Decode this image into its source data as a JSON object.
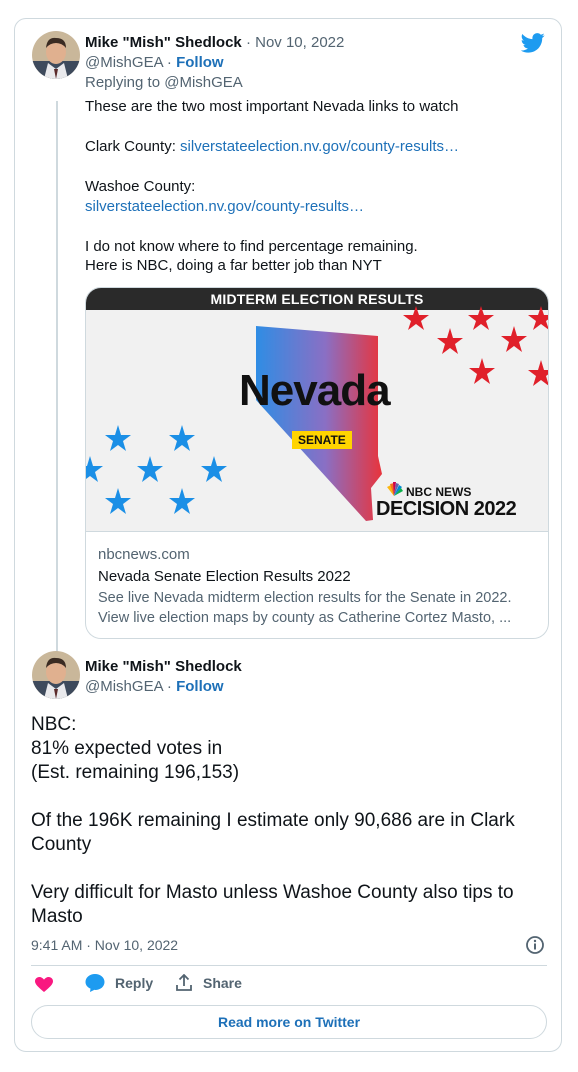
{
  "tweet1": {
    "author_name": "Mike \"Mish\" Shedlock",
    "separator": "·",
    "date": "Nov 10, 2022",
    "handle": "@MishGEA",
    "follow_label": "Follow",
    "replying_to_prefix": "Replying to",
    "replying_to_handle": "@MishGEA",
    "line1": "These are the two most important Nevada links to watch",
    "clark_label": "Clark County:",
    "clark_link": "silverstateelection.nv.gov/county-results…",
    "washoe_label": "Washoe County:",
    "washoe_link": "silverstateelection.nv.gov/county-results…",
    "line_no_know": "I do not know where to find percentage remaining.",
    "line_nbc": "Here is NBC, doing a far better job than NYT"
  },
  "preview": {
    "banner": "MIDTERM ELECTION RESULTS",
    "state": "Nevada",
    "race_badge": "SENATE",
    "network": "NBC NEWS",
    "decision": "DECISION 2022",
    "domain": "nbcnews.com",
    "title": "Nevada Senate Election Results 2022",
    "desc_line1": "See live Nevada midterm election results for the Senate in 2022.",
    "desc_line2": "View live election maps by county as Catherine Cortez Masto, ..."
  },
  "tweet2": {
    "author_name": "Mike \"Mish\" Shedlock",
    "handle": "@MishGEA",
    "separator": "·",
    "follow_label": "Follow",
    "l1": "NBC:",
    "l2": "81% expected votes in",
    "l3": "(Est. remaining 196,153)",
    "l4": "Of the 196K remaining I estimate only 90,686 are in Clark",
    "l5": "County",
    "l6": "Very difficult for Masto unless Washoe County also tips to",
    "l7": "Masto",
    "timestamp": "9:41 AM · Nov 10, 2022"
  },
  "actions": {
    "reply_label": "Reply",
    "share_label": "Share",
    "read_more_label": "Read more on Twitter"
  },
  "colors": {
    "link": "#1d70b8",
    "heart": "#f91880",
    "twitter_blue": "#1d9bf0",
    "star_red": "#e0202a",
    "star_blue": "#1b8fe6"
  }
}
